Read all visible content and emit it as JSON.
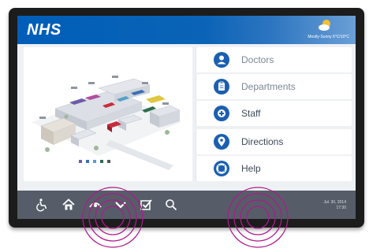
{
  "header": {
    "logo": "NHS",
    "weather": {
      "icon": "partly-sunny-icon",
      "text": "Mostly-Sunny 6°C/10°C"
    }
  },
  "map": {
    "icon": "hospital-campus-map",
    "legend": [
      {
        "label": "",
        "color": "#6e5aa8"
      },
      {
        "label": "",
        "color": "#3b6fb6"
      },
      {
        "label": "",
        "color": "#56a0c8"
      },
      {
        "label": "",
        "color": "#2d6e4e"
      },
      {
        "label": "",
        "color": "#555555"
      }
    ]
  },
  "menu": {
    "items": [
      {
        "label": "Doctors",
        "icon": "doctor-icon"
      },
      {
        "label": "Departments",
        "icon": "clipboard-icon"
      },
      {
        "label": "Staff",
        "icon": "plus-icon"
      },
      {
        "label": "Directions",
        "icon": "location-pin-icon"
      },
      {
        "label": "Help",
        "icon": "lifebuoy-icon"
      }
    ]
  },
  "taskbar": {
    "icons": [
      "accessibility-icon",
      "home-icon",
      "eye-icon",
      "chevron-down-icon",
      "checkbox-icon",
      "search-icon"
    ],
    "date": "Jul. 30, 2014",
    "time": "17:30"
  },
  "colors": {
    "header_blue": "#005eb8",
    "icon_blue": "#1b5fb0",
    "taskbar_gray": "#565d68",
    "ripple_magenta": "#b0198e"
  }
}
